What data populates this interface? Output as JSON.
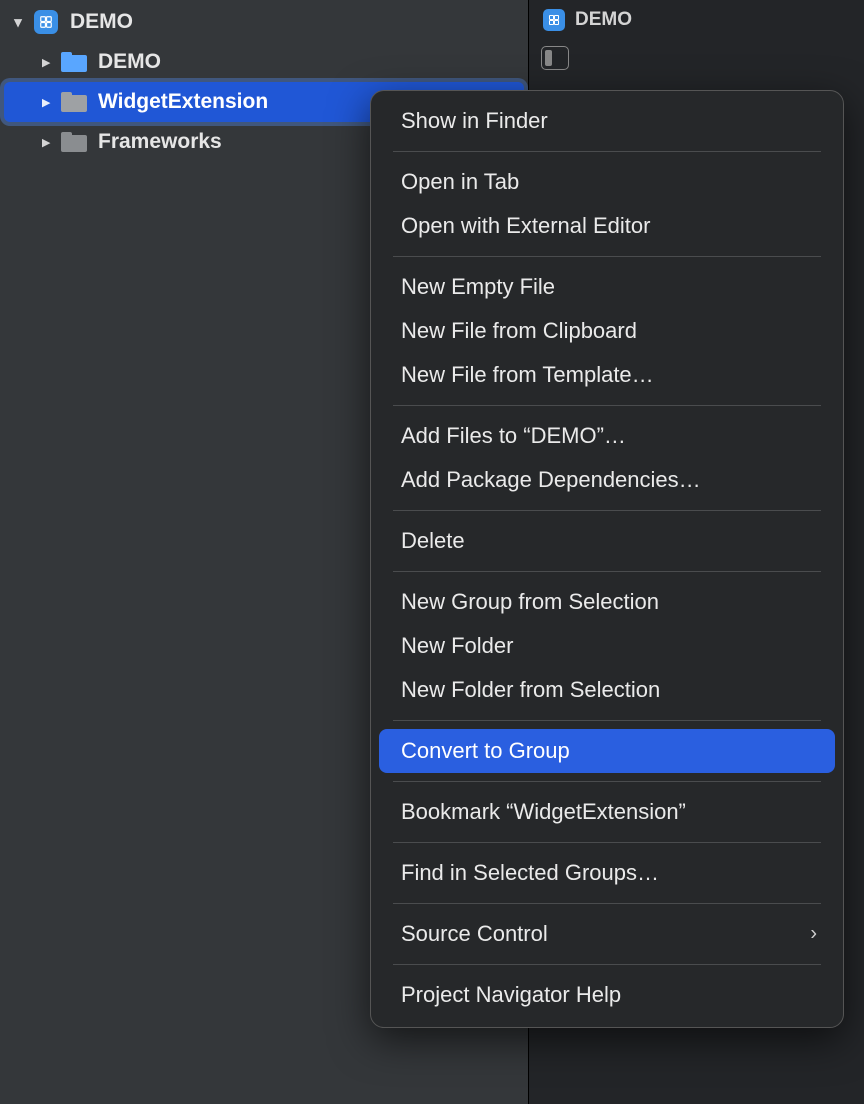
{
  "navigator": {
    "project": "DEMO",
    "items": [
      {
        "label": "DEMO",
        "indent": 1,
        "icon": "folder-blue",
        "selected": false,
        "disclosure": "right"
      },
      {
        "label": "WidgetExtension",
        "indent": 1,
        "icon": "folder-gray-light",
        "selected": true,
        "disclosure": "right"
      },
      {
        "label": "Frameworks",
        "indent": 1,
        "icon": "folder-gray",
        "selected": false,
        "disclosure": "right"
      }
    ]
  },
  "detail": {
    "title": "DEMO"
  },
  "context_menu": {
    "groups": [
      [
        {
          "label": "Show in Finder"
        }
      ],
      [
        {
          "label": "Open in Tab"
        },
        {
          "label": "Open with External Editor"
        }
      ],
      [
        {
          "label": "New Empty File"
        },
        {
          "label": "New File from Clipboard"
        },
        {
          "label": "New File from Template…"
        }
      ],
      [
        {
          "label": "Add Files to “DEMO”…"
        },
        {
          "label": "Add Package Dependencies…"
        }
      ],
      [
        {
          "label": "Delete"
        }
      ],
      [
        {
          "label": "New Group from Selection"
        },
        {
          "label": "New Folder"
        },
        {
          "label": "New Folder from Selection"
        }
      ],
      [
        {
          "label": "Convert to Group",
          "highlight": true
        }
      ],
      [
        {
          "label": "Bookmark “WidgetExtension”"
        }
      ],
      [
        {
          "label": "Find in Selected Groups…"
        }
      ],
      [
        {
          "label": "Source Control",
          "submenu": true
        }
      ],
      [
        {
          "label": "Project Navigator Help"
        }
      ]
    ]
  }
}
